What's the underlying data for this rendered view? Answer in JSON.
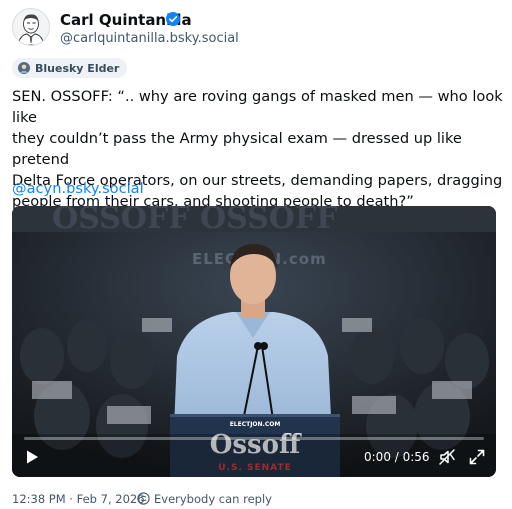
{
  "author": {
    "display_name": "Carl Quintanilla",
    "handle": "@carlquintanilla.bsky.social",
    "avatar_icon": "portrait-sketch-avatar",
    "verified_icon": "verified-check-icon",
    "verified_color": "#1083fe"
  },
  "badge": {
    "label": "Bluesky Elder",
    "icon": "badge-avatar-icon"
  },
  "post": {
    "lines": [
      "SEN. OSSOFF: “.. why are roving gangs of masked men — who look like",
      "they couldn’t pass the Army physical exam — dressed up like pretend",
      "Delta Force operators, on our streets, demanding papers, dragging",
      "people from their cars, and shooting people to death?”"
    ],
    "link": "@acyn.bsky.social",
    "link_color": "#1083fe"
  },
  "video": {
    "sign_top": "ELECTJON.com",
    "podium_small": "ELECTJON.COM",
    "podium_name": "Ossoff",
    "podium_sub": "U.S. SENATE",
    "time": "0:00 / 0:56",
    "progress": 0.0,
    "play_icon": "play-icon",
    "mute_icon": "volume-muted-icon",
    "fullscreen_icon": "fullscreen-icon"
  },
  "footer": {
    "timestamp": "12:38 PM · Feb 7, 2026",
    "reply_icon": "reply-setting-icon",
    "reply_setting": "Everybody can reply"
  }
}
